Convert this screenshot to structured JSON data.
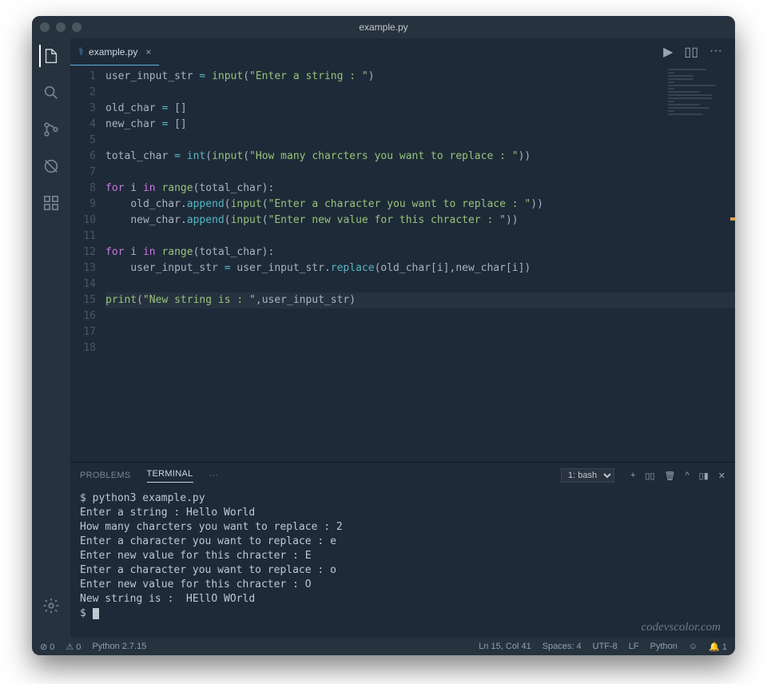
{
  "window": {
    "title": "example.py"
  },
  "tab": {
    "label": "example.py",
    "close_symbol": "×"
  },
  "tab_controls": {
    "run": "▶",
    "split": "▯▯",
    "more": "···"
  },
  "activity_icons": [
    "explorer",
    "search",
    "scm",
    "debug",
    "extensions",
    "settings"
  ],
  "editor": {
    "line_numbers": [
      "1",
      "2",
      "3",
      "4",
      "5",
      "6",
      "7",
      "8",
      "9",
      "10",
      "11",
      "12",
      "13",
      "14",
      "15",
      "16",
      "17",
      "18"
    ],
    "lines": [
      {
        "t": "assign",
        "var": "user_input_str",
        "op": " = ",
        "call": "input",
        "paren_open": "(",
        "str": "\"Enter a string : \"",
        "paren_close": ")"
      },
      {
        "t": "blank"
      },
      {
        "t": "assign_lit",
        "var": "old_char",
        "op": " = ",
        "lit": "[]"
      },
      {
        "t": "assign_lit",
        "var": "new_char",
        "op": " = ",
        "lit": "[]"
      },
      {
        "t": "blank"
      },
      {
        "t": "assign_nested",
        "var": "total_char",
        "op": " = ",
        "outer": "int",
        "inner": "input",
        "str": "\"How many charcters you want to replace : \""
      },
      {
        "t": "blank"
      },
      {
        "t": "for",
        "kw1": "for",
        "iter": " i ",
        "kw2": "in",
        "rng": " range",
        "args": "(total_char):"
      },
      {
        "t": "method",
        "indent": "    ",
        "obj": "old_char",
        "dot": ".",
        "meth": "append",
        "inner": "input",
        "str": "\"Enter a character you want to replace : \""
      },
      {
        "t": "method",
        "indent": "    ",
        "obj": "new_char",
        "dot": ".",
        "meth": "append",
        "inner": "input",
        "str": "\"Enter new value for this chracter : \""
      },
      {
        "t": "blank"
      },
      {
        "t": "for",
        "kw1": "for",
        "iter": " i ",
        "kw2": "in",
        "rng": " range",
        "args": "(total_char):"
      },
      {
        "t": "replace",
        "indent": "    ",
        "var": "user_input_str",
        "op": " = ",
        "obj": "user_input_str",
        "dot": ".",
        "meth": "replace",
        "args": "(old_char[i],new_char[i])"
      },
      {
        "t": "blank"
      },
      {
        "t": "print",
        "call": "print",
        "paren_open": "(",
        "str": "\"New string is : \"",
        "comma": ",",
        "var": "user_input_str",
        "paren_close": ")",
        "hl": true
      },
      {
        "t": "blank"
      },
      {
        "t": "blank"
      },
      {
        "t": "blank"
      }
    ]
  },
  "panel": {
    "tabs": {
      "problems": "PROBLEMS",
      "terminal": "TERMINAL",
      "more": "···"
    },
    "dropdown": "1: bash",
    "controls_glyphs": {
      "add": "+",
      "split": "▯▯",
      "trash": "🗑",
      "up": "^",
      "layout": "▯▮",
      "close": "✕"
    }
  },
  "terminal_lines": [
    "$ python3 example.py",
    "Enter a string : Hello World",
    "How many charcters you want to replace : 2",
    "Enter a character you want to replace : e",
    "Enter new value for this chracter : E",
    "Enter a character you want to replace : o",
    "Enter new value for this chracter : O",
    "New string is :  HEllO WOrld",
    "$ "
  ],
  "statusbar": {
    "errors": "⊘ 0",
    "warnings": "⚠ 0",
    "python_ver": "Python 2.7.15",
    "pos": "Ln 15, Col 41",
    "spaces": "Spaces: 4",
    "encoding": "UTF-8",
    "eol": "LF",
    "lang": "Python",
    "smile": "☺",
    "bell": "🔔 1"
  },
  "watermark": "codevscolor.com"
}
